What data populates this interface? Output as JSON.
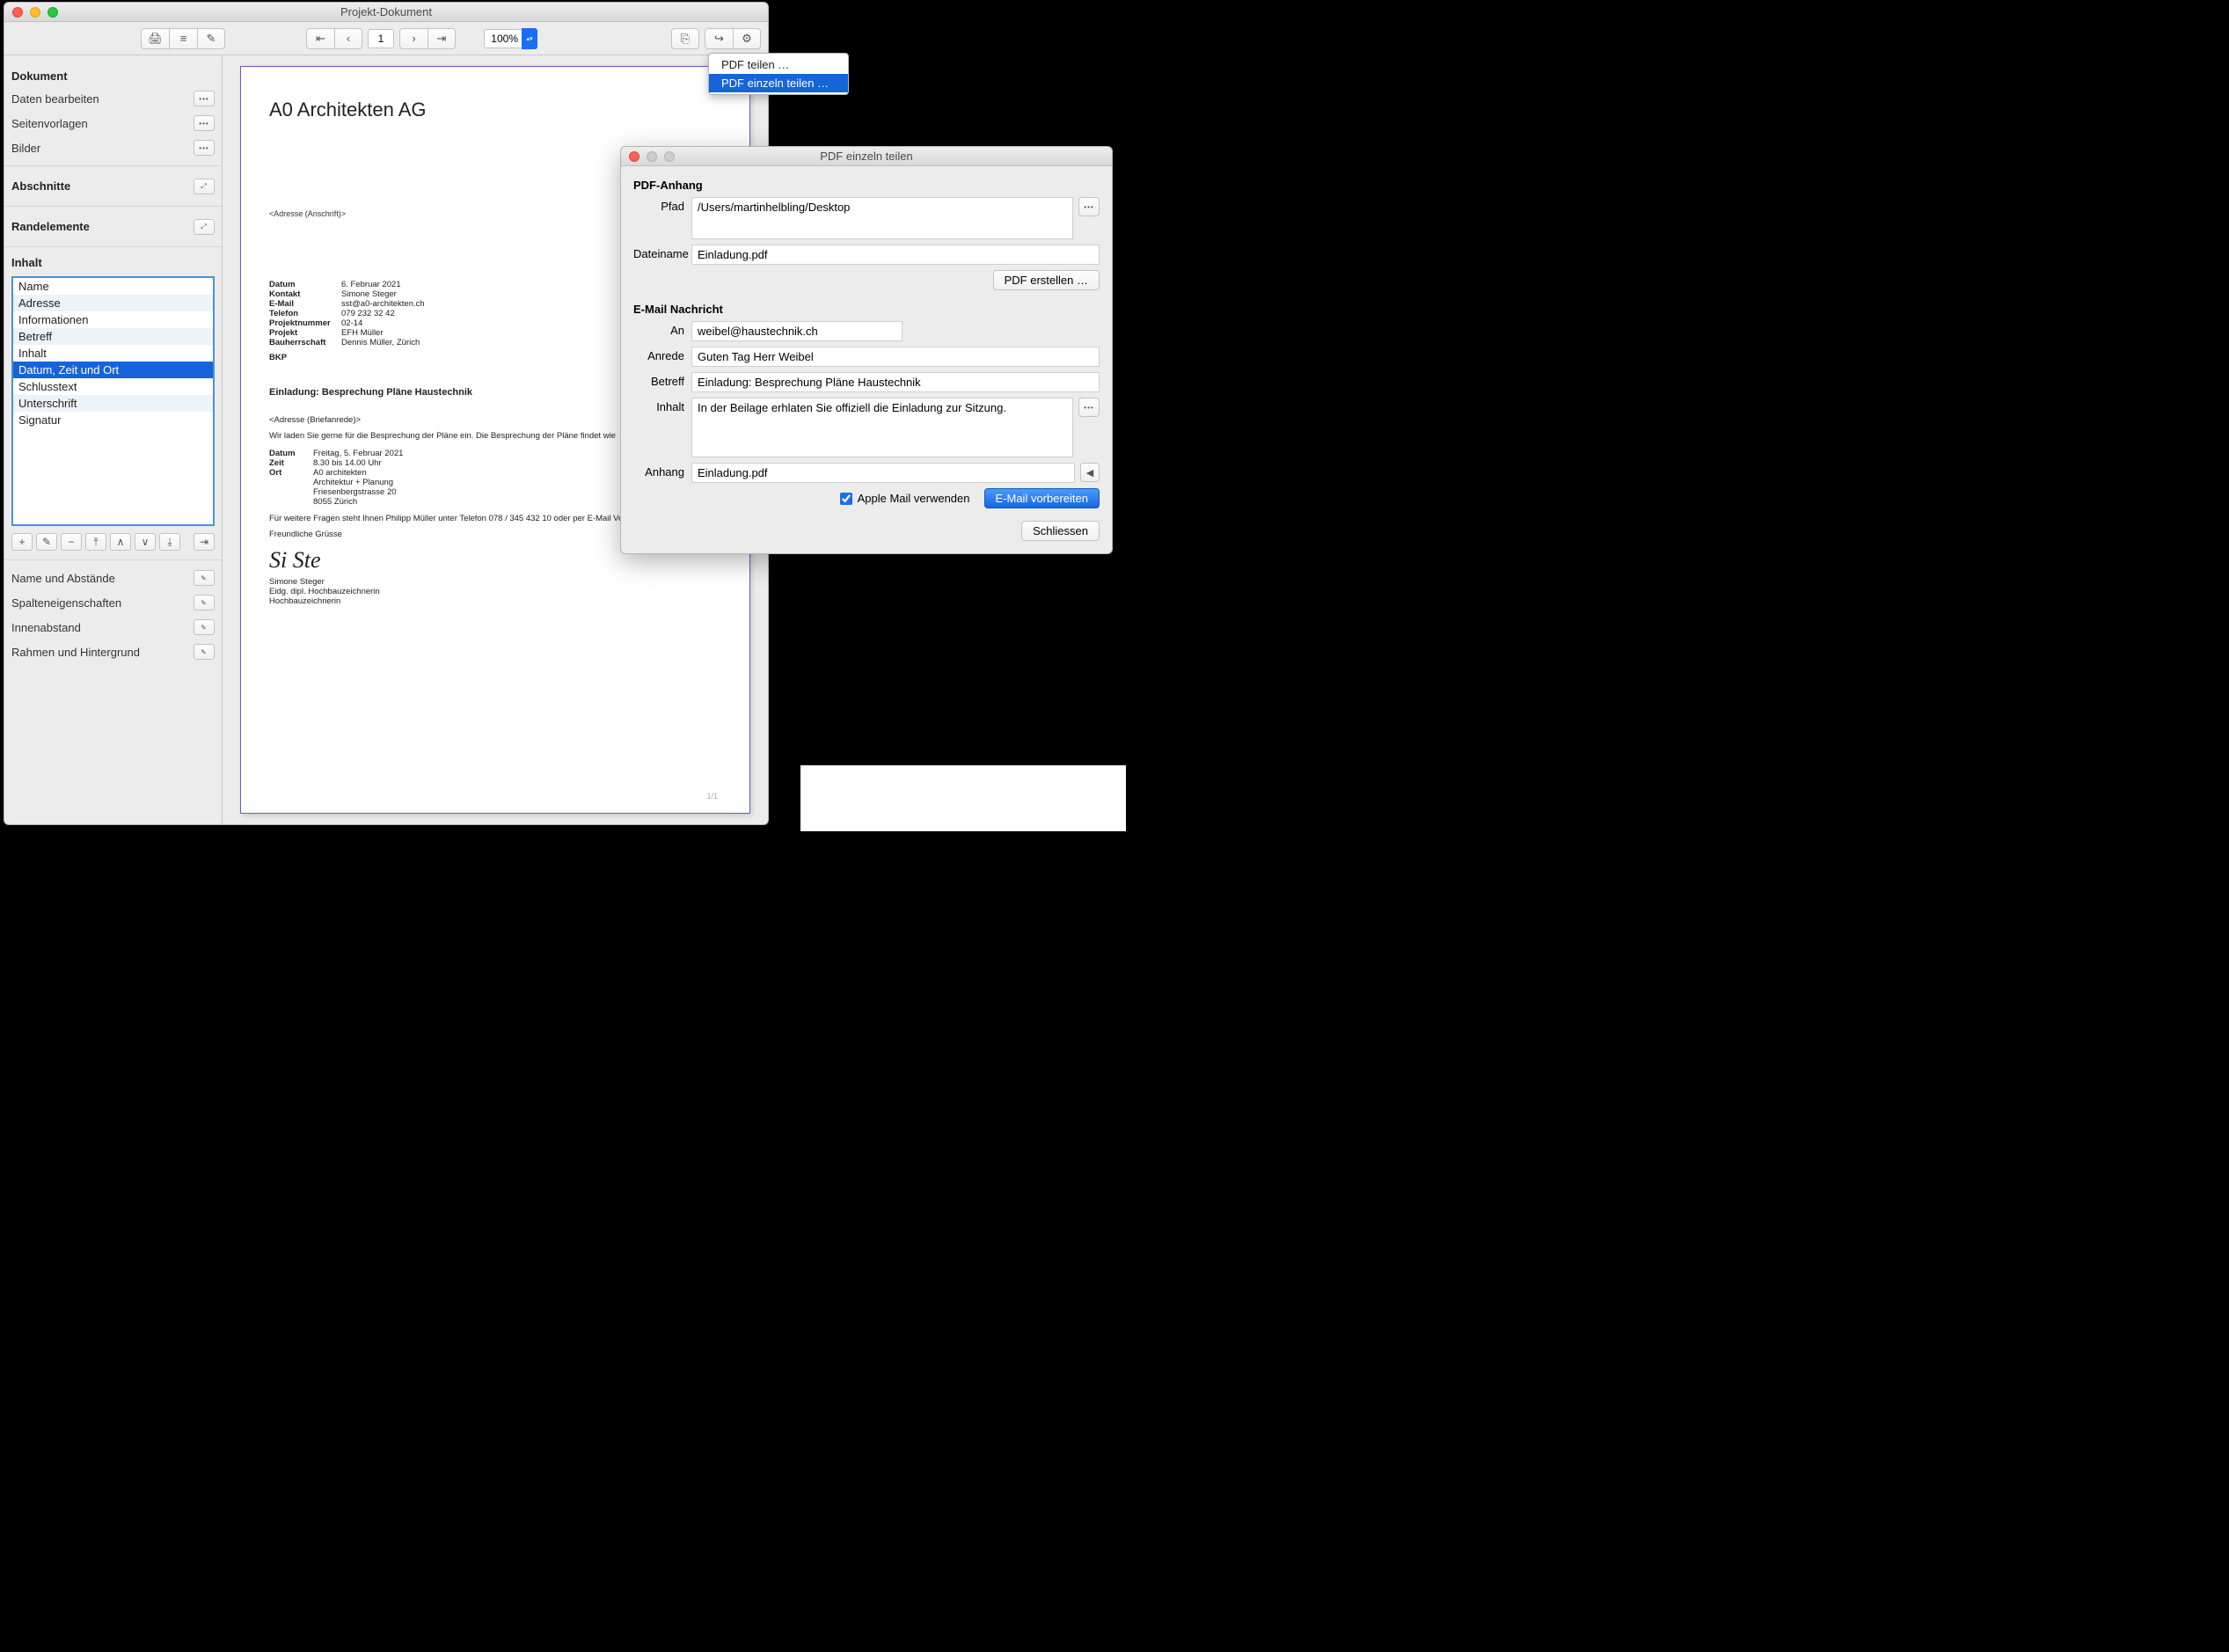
{
  "windows": {
    "main_title": "Projekt-Dokument",
    "dialog_title": "PDF einzeln teilen"
  },
  "toolbar": {
    "page": "1",
    "zoom": "100%"
  },
  "sidebar": {
    "headers": {
      "dokument": "Dokument",
      "abschnitte": "Abschnitte",
      "randelemente": "Randelemente",
      "inhalt": "Inhalt"
    },
    "dokument_items": {
      "daten": "Daten bearbeiten",
      "seitenvorlagen": "Seitenvorlagen",
      "bilder": "Bilder"
    },
    "inhalt_items": [
      "Name",
      "Adresse",
      "Informationen",
      "Betreff",
      "Inhalt",
      "Datum, Zeit und Ort",
      "Schlusstext",
      "Unterschrift",
      "Signatur"
    ],
    "props": {
      "name_abstand": "Name und Abstände",
      "spalten": "Spalteneigenschaften",
      "innenabstand": "Innenabstand",
      "rahmen": "Rahmen und Hintergrund"
    }
  },
  "share_menu": {
    "item1": "PDF teilen …",
    "item2": "PDF einzeln teilen …"
  },
  "doc": {
    "company": "A0 Architekten AG",
    "addr_placeholder": "<Adresse (Anschrift)>",
    "meta_labels": {
      "datum": "Datum",
      "kontakt": "Kontakt",
      "email": "E-Mail",
      "telefon": "Telefon",
      "projektnr": "Projektnummer",
      "projekt": "Projekt",
      "bauherr": "Bauherrschaft"
    },
    "meta": {
      "datum": "6. Februar 2021",
      "kontakt": "Simone Steger",
      "email": "sst@a0-architekten.ch",
      "telefon": "079 232 32 42",
      "projektnr": "02-14",
      "projekt": "EFH Müller",
      "bauherr": "Dennis Müller, Zürich"
    },
    "bkp": "BKP",
    "subject": "Einladung: Besprechung Pläne Haustechnik",
    "anrede_placeholder": "<Adresse (Briefanrede)>",
    "body1": "Wir laden Sie gerne für die Besprechung der Pläne ein. Die Besprechung der Pläne findet wie",
    "details_labels": {
      "datum": "Datum",
      "zeit": "Zeit",
      "ort": "Ort"
    },
    "details": {
      "datum": "Freitag, 5. Februar 2021",
      "zeit": "8.30 bis 14.00 Uhr",
      "ort1": "A0 architekten",
      "ort2": "Architektur + Planung",
      "ort3": "Friesenbergstrasse 20",
      "ort4": "8055 Zürich"
    },
    "body2": "Für weitere Fragen steht Ihnen Philipp Müller unter Telefon 078 / 345 432 10 oder per E-Mail Verfügung.",
    "gruss": "Freundliche Grüsse",
    "sig": "Si Ste",
    "sig_name": "Simone Steger",
    "sig_title1": "Eidg. dipl. Hochbauzeichnerin",
    "sig_title2": "Hochbauzeichnerin",
    "pagenum": "1/1"
  },
  "dialog": {
    "sec1": "PDF-Anhang",
    "labels": {
      "pfad": "Pfad",
      "dateiname": "Dateiname",
      "an": "An",
      "anrede": "Anrede",
      "betreff": "Betreff",
      "inhalt": "Inhalt",
      "anhang": "Anhang"
    },
    "pfad": "/Users/martinhelbling/Desktop",
    "dateiname": "Einladung.pdf",
    "btn_pdf": "PDF erstellen …",
    "sec2": "E-Mail Nachricht",
    "an": "weibel@haustechnik.ch",
    "anrede": "Guten Tag Herr Weibel",
    "betreff": "Einladung: Besprechung Pläne Haustechnik",
    "inhalt": "In der Beilage erhlaten Sie offiziell die Einladung zur Sitzung.",
    "anhang": "Einladung.pdf",
    "check": "Apple Mail verwenden",
    "btn_prepare": "E-Mail vorbereiten",
    "btn_close": "Schliessen"
  }
}
